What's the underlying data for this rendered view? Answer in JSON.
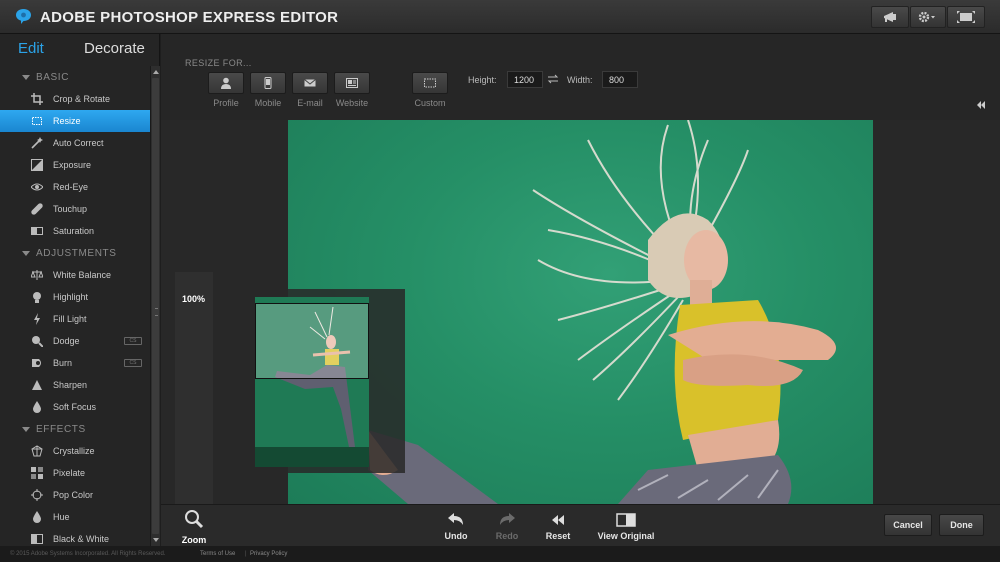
{
  "app": {
    "title": "ADOBE PHOTOSHOP EXPRESS EDITOR"
  },
  "tabs": {
    "edit": "Edit",
    "decorate": "Decorate"
  },
  "sections": {
    "basic": "BASIC",
    "adjustments": "ADJUSTMENTS",
    "effects": "EFFECTS"
  },
  "basic_tools": [
    {
      "label": "Crop & Rotate",
      "icon": "crop-icon"
    },
    {
      "label": "Resize",
      "icon": "resize-icon",
      "active": true
    },
    {
      "label": "Auto Correct",
      "icon": "magic-wand-icon"
    },
    {
      "label": "Exposure",
      "icon": "exposure-icon"
    },
    {
      "label": "Red-Eye",
      "icon": "eye-icon"
    },
    {
      "label": "Touchup",
      "icon": "bandage-icon"
    },
    {
      "label": "Saturation",
      "icon": "saturation-icon"
    }
  ],
  "adjustment_tools": [
    {
      "label": "White Balance",
      "icon": "scale-icon"
    },
    {
      "label": "Highlight",
      "icon": "bulb-icon"
    },
    {
      "label": "Fill Light",
      "icon": "lightning-icon"
    },
    {
      "label": "Dodge",
      "icon": "dodge-icon",
      "badge": "CS"
    },
    {
      "label": "Burn",
      "icon": "burn-icon",
      "badge": "CS"
    },
    {
      "label": "Sharpen",
      "icon": "triangle-icon"
    },
    {
      "label": "Soft Focus",
      "icon": "drop-icon"
    }
  ],
  "effect_tools": [
    {
      "label": "Crystallize",
      "icon": "crystal-icon"
    },
    {
      "label": "Pixelate",
      "icon": "grid-icon"
    },
    {
      "label": "Pop Color",
      "icon": "target-icon"
    },
    {
      "label": "Hue",
      "icon": "hue-icon"
    },
    {
      "label": "Black & White",
      "icon": "bw-icon"
    }
  ],
  "resize": {
    "heading": "RESIZE FOR...",
    "presets": [
      {
        "label": "Profile",
        "icon": "person-icon"
      },
      {
        "label": "Mobile",
        "icon": "phone-icon"
      },
      {
        "label": "E-mail",
        "icon": "envelope-icon"
      },
      {
        "label": "Website",
        "icon": "webpage-icon"
      }
    ],
    "custom_label": "Custom",
    "height_label": "Height:",
    "height_value": "1200",
    "width_label": "Width:",
    "width_value": "800"
  },
  "zoom": {
    "percent": "100%",
    "label": "Zoom"
  },
  "actions": {
    "undo": "Undo",
    "redo": "Redo",
    "reset": "Reset",
    "view_original": "View Original",
    "cancel": "Cancel",
    "done": "Done"
  },
  "footer": {
    "copyright": "© 2015 Adobe Systems Incorporated. All Rights Reserved.",
    "terms": "Terms of Use",
    "privacy": "Privacy Policy"
  },
  "colors": {
    "accent": "#2ba3e8",
    "photo_bg": "#258f66"
  }
}
